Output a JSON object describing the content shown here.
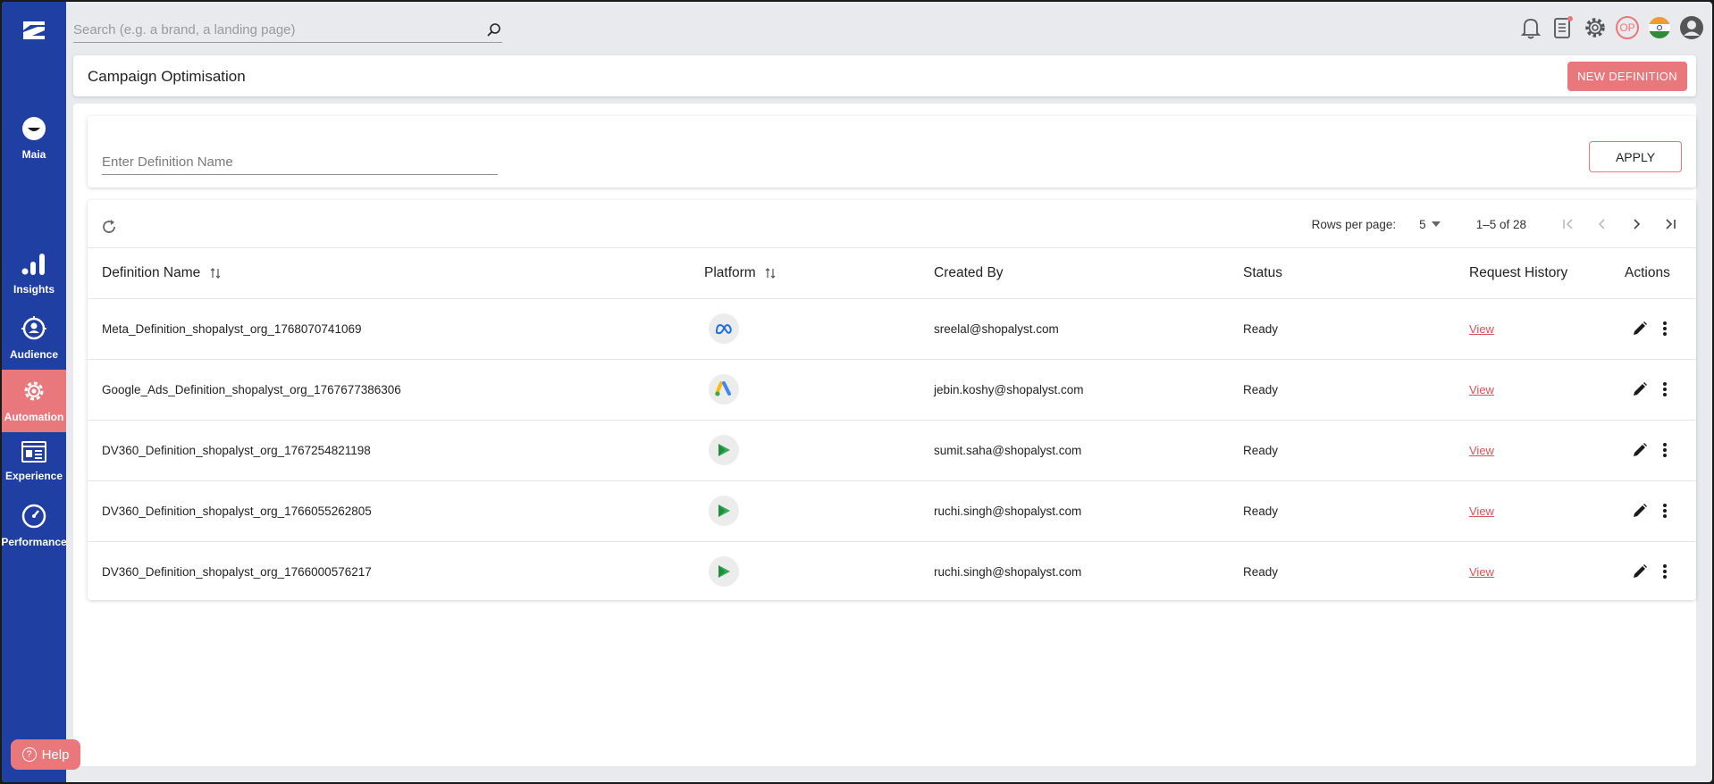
{
  "search": {
    "placeholder": "Search (e.g. a brand, a landing page)"
  },
  "sidebar": {
    "items": [
      {
        "label": "Maia",
        "icon": "maia-logo-icon"
      },
      {
        "label": "Insights",
        "icon": "bar-chart-icon"
      },
      {
        "label": "Audience",
        "icon": "audience-target-icon"
      },
      {
        "label": "Automation",
        "icon": "gear-icon",
        "active": true
      },
      {
        "label": "Experience",
        "icon": "layout-icon"
      },
      {
        "label": "Performance",
        "icon": "speedometer-icon"
      }
    ],
    "help_label": "Help"
  },
  "topbar": {
    "user_initials": "OP"
  },
  "header": {
    "title": "Campaign Optimisation",
    "new_button": "NEW DEFINITION"
  },
  "filter": {
    "placeholder": "Enter Definition Name",
    "apply_label": "APPLY"
  },
  "pagination": {
    "rows_per_page_label": "Rows per page:",
    "rows_per_page": "5",
    "range": "1–5 of 28"
  },
  "table": {
    "columns": [
      "Definition Name",
      "Platform",
      "Created By",
      "Status",
      "Request History",
      "Actions"
    ],
    "rows": [
      {
        "name": "Meta_Definition_shopalyst_org_1768070741069",
        "platform": "meta",
        "created_by": "sreelal@shopalyst.com",
        "status": "Ready",
        "history": "View"
      },
      {
        "name": "Google_Ads_Definition_shopalyst_org_1767677386306",
        "platform": "google-ads",
        "created_by": "jebin.koshy@shopalyst.com",
        "status": "Ready",
        "history": "View"
      },
      {
        "name": "DV360_Definition_shopalyst_org_1767254821198",
        "platform": "dv360",
        "created_by": "sumit.saha@shopalyst.com",
        "status": "Ready",
        "history": "View"
      },
      {
        "name": "DV360_Definition_shopalyst_org_1766055262805",
        "platform": "dv360",
        "created_by": "ruchi.singh@shopalyst.com",
        "status": "Ready",
        "history": "View"
      },
      {
        "name": "DV360_Definition_shopalyst_org_1766000576217",
        "platform": "dv360",
        "created_by": "ruchi.singh@shopalyst.com",
        "status": "Ready",
        "history": "View"
      }
    ]
  },
  "colors": {
    "sidebar": "#1f3fa3",
    "accent": "#e9787c"
  }
}
